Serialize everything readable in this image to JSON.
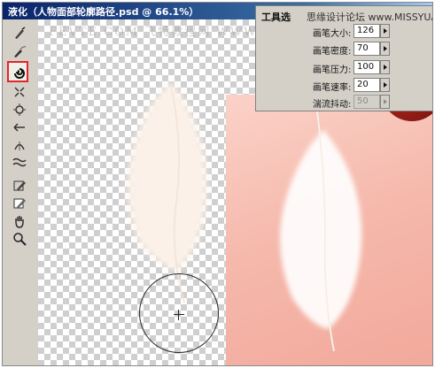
{
  "window": {
    "title": "液化（人物面部轮廓路径.psd @ 66.1%）"
  },
  "watermark": {
    "text": "FEVTE.COM 飞特教程网 WWW.TEVI.NET"
  },
  "toolbar": {
    "tools": [
      {
        "name": "forward-warp-tool",
        "selected": false
      },
      {
        "name": "reconstruct-tool",
        "selected": false
      },
      {
        "name": "twirl-clockwise-tool",
        "selected": true
      },
      {
        "name": "pucker-tool",
        "selected": false
      },
      {
        "name": "bloat-tool",
        "selected": false
      },
      {
        "name": "push-left-tool",
        "selected": false
      },
      {
        "name": "mirror-tool",
        "selected": false
      },
      {
        "name": "turbulence-tool",
        "selected": false
      },
      {
        "name": "freeze-mask-tool",
        "selected": false
      },
      {
        "name": "thaw-mask-tool",
        "selected": false
      },
      {
        "name": "hand-tool",
        "selected": false
      },
      {
        "name": "zoom-tool",
        "selected": false
      }
    ]
  },
  "tool_options": {
    "title": "工具选",
    "site_label": "思缘设计论坛 www.MISSYUAN.COM",
    "brush_size": {
      "label": "画笔大小:",
      "value": "126"
    },
    "brush_density": {
      "label": "画笔密度:",
      "value": "70"
    },
    "brush_pressure": {
      "label": "画笔压力:",
      "value": "100"
    },
    "brush_rate": {
      "label": "画笔速率:",
      "value": "20"
    },
    "turbulent_jitter": {
      "label": "湍流抖动:",
      "value": "50",
      "disabled": true
    }
  },
  "colors": {
    "selection_outline": "#e2262a",
    "title_bar": "#0a246a",
    "photo_background": "#f5b8ab"
  }
}
